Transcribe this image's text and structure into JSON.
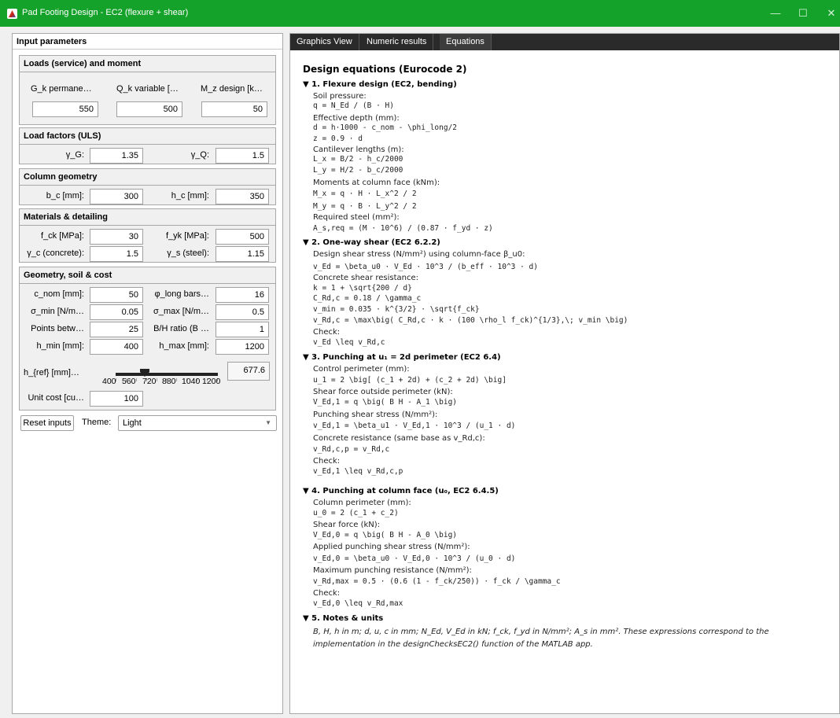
{
  "window": {
    "title": "Pad Footing Design - EC2 (flexure + shear)",
    "controls": {
      "minimize": "—",
      "maximize": "☐",
      "close": "✕"
    }
  },
  "input_panel": {
    "title": "Input parameters",
    "loads": {
      "title": "Loads (service) and moment",
      "headers": [
        "G_k permane…",
        "Q_k variable […",
        "M_z design [k…"
      ],
      "values": [
        "550",
        "500",
        "50"
      ]
    },
    "load_factors": {
      "title": "Load factors (ULS)",
      "gamma_g_label": "γ_G:",
      "gamma_g": "1.35",
      "gamma_q_label": "γ_Q:",
      "gamma_q": "1.5"
    },
    "column": {
      "title": "Column geometry",
      "bc_label": "b_c [mm]:",
      "bc": "300",
      "hc_label": "h_c [mm]:",
      "hc": "350"
    },
    "materials": {
      "title": "Materials & detailing",
      "fck_label": "f_ck [MPa]:",
      "fck": "30",
      "fyk_label": "f_yk [MPa]:",
      "fyk": "500",
      "gc_label": "γ_c (concrete):",
      "gc": "1.5",
      "gs_label": "γ_s (steel):",
      "gs": "1.15"
    },
    "geometry": {
      "title": "Geometry, soil & cost",
      "cnom_label": "c_nom [mm]:",
      "cnom": "50",
      "phi_label": "φ_long bars…",
      "phi": "16",
      "smin_label": "σ_min [N/m…",
      "smin": "0.05",
      "smax_label": "σ_max [N/m…",
      "smax": "0.5",
      "pts_label": "Points betw…",
      "pts": "25",
      "bh_label": "B/H ratio (B …",
      "bh": "1",
      "hmin_label": "h_min [mm]:",
      "hmin": "400",
      "hmax_label": "h_max [mm]:",
      "hmax": "1200",
      "href_label": "h_{ref} [mm]…",
      "href": "677.6",
      "slider_ticks": [
        "400",
        "560",
        "720",
        "880",
        "1040",
        "1200"
      ],
      "slider_value": 677.6,
      "cost_label": "Unit cost [cu…",
      "cost": "100"
    },
    "reset_label": "Reset inputs",
    "theme_label": "Theme:",
    "theme_value": "Light"
  },
  "tabs": [
    "Graphics View",
    "Numeric results",
    "Equations"
  ],
  "equations": {
    "title": "Design equations (Eurocode 2)",
    "s1": {
      "title": "▼ 1. Flexure design (EC2, bending)",
      "l1": "Soil pressure:",
      "e1": "q = N_Ed / (B · H)",
      "l2": "Effective depth (mm):",
      "e2": "d = h·1000 - c_nom - \\phi_long/2",
      "e3": "z = 0.9 · d",
      "l3": "Cantilever lengths (m):",
      "e4": "L_x = B/2 - h_c/2000",
      "e5": "L_y = H/2 - b_c/2000",
      "l4": "Moments at column face (kNm):",
      "e6": "M_x = q · H · L_x^2 / 2",
      "e7": "M_y = q · B · L_y^2 / 2",
      "l5": "Required steel (mm²):",
      "e8": "A_s,req = (M · 10^6) / (0.87 · f_yd · z)"
    },
    "s2": {
      "title": "▼ 2. One-way shear (EC2 6.2.2)",
      "l1": "Design shear stress (N/mm²) using column-face β_u0:",
      "e1": "v_Ed = \\beta_u0 · V_Ed · 10^3 / (b_eff · 10^3 · d)",
      "l2": "Concrete shear resistance:",
      "e2": "k = 1 + \\sqrt{200 / d}",
      "e3": "C_Rd,c = 0.18 / \\gamma_c",
      "e4": "v_min = 0.035 · k^{3/2} · \\sqrt{f_ck}",
      "e5": "v_Rd,c = \\max\\big( C_Rd,c · k · (100 \\rho_l f_ck)^{1/3},\\; v_min \\big)",
      "l3": "Check:",
      "e6": "v_Ed \\leq v_Rd,c"
    },
    "s3": {
      "title": "▼ 3. Punching at u₁ = 2d perimeter (EC2 6.4)",
      "l1": "Control perimeter (mm):",
      "e1": "u_1 = 2 \\big[ (c_1 + 2d) + (c_2 + 2d) \\big]",
      "l2": "Shear force outside perimeter (kN):",
      "e2": "V_Ed,1 = q \\big( B H - A_1 \\big)",
      "l3": "Punching shear stress (N/mm²):",
      "e3": "v_Ed,1 = \\beta_u1 · V_Ed,1 · 10^3 / (u_1 · d)",
      "l4": "Concrete resistance (same base as v_Rd,c):",
      "e4": "v_Rd,c,p = v_Rd,c",
      "l5": "Check:",
      "e5": "v_Ed,1 \\leq v_Rd,c,p"
    },
    "s4": {
      "title": "▼ 4. Punching at column face (u₀, EC2 6.4.5)",
      "l1": "Column perimeter (mm):",
      "e1": "u_0 = 2 (c_1 + c_2)",
      "l2": "Shear force (kN):",
      "e2": "V_Ed,0 = q \\big( B H - A_0 \\big)",
      "l3": "Applied punching shear stress (N/mm²):",
      "e3": "v_Ed,0 = \\beta_u0 · V_Ed,0 · 10^3 / (u_0 · d)",
      "l4": "Maximum punching resistance (N/mm²):",
      "e4": "v_Rd,max = 0.5 · (0.6 (1 - f_ck/250)) · f_ck / \\gamma_c",
      "l5": "Check:",
      "e5": "v_Ed,0 \\leq v_Rd,max"
    },
    "s5": {
      "title": "▼ 5. Notes & units",
      "note": "B, H, h in m; d, u, c in mm; N_Ed, V_Ed in kN; f_ck, f_yd in N/mm²; A_s in mm². These expressions correspond to the implementation in the designChecksEC2() function of the MATLAB app."
    }
  }
}
